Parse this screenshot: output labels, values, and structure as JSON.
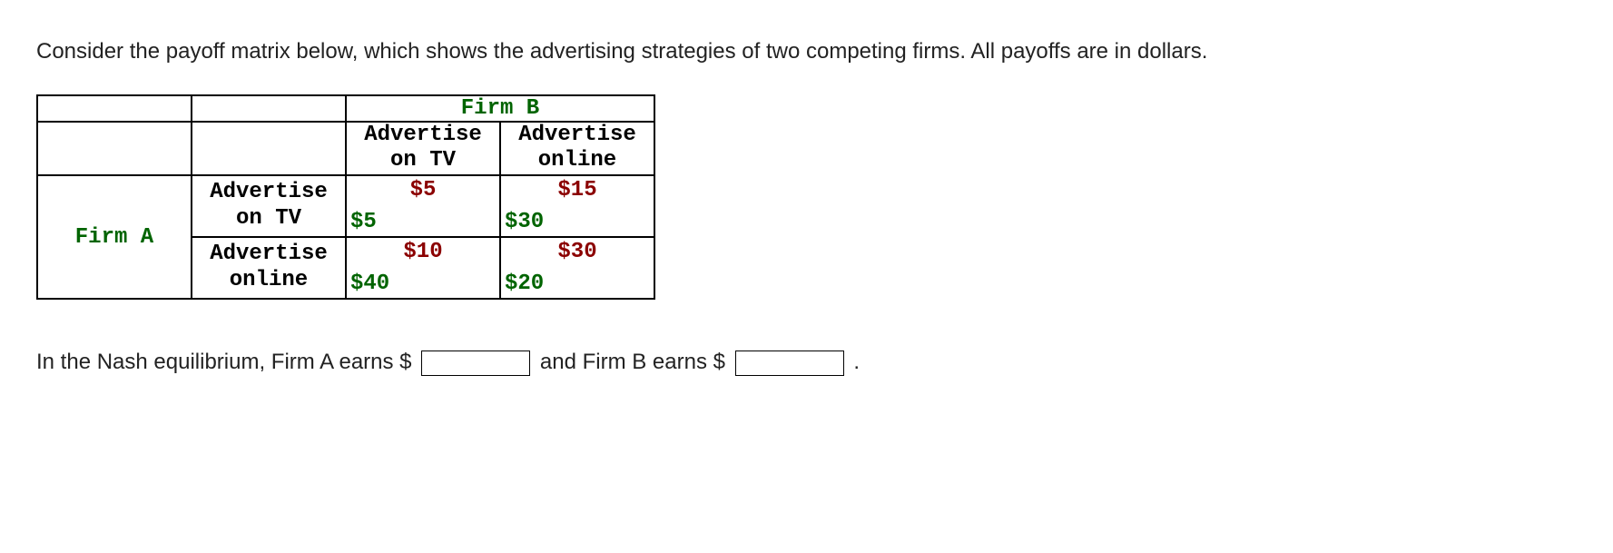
{
  "intro": "Consider the payoff matrix below, which shows the advertising strategies of two competing firms. All payoffs are in dollars.",
  "firmBLabel": "Firm B",
  "firmALabel": "Firm A",
  "firmBStrategies": {
    "tv": {
      "line1": "Advertise",
      "line2": "on TV"
    },
    "online": {
      "line1": "Advertise",
      "line2": "online"
    }
  },
  "firmAStrategies": {
    "tv": {
      "line1": "Advertise",
      "line2": "on TV"
    },
    "online": {
      "line1": "Advertise",
      "line2": "online"
    }
  },
  "payoffs": {
    "tv_tv": {
      "a": "$5",
      "b": "$5"
    },
    "tv_online": {
      "a": "$15",
      "b": "$30"
    },
    "online_tv": {
      "a": "$10",
      "b": "$40"
    },
    "online_online": {
      "a": "$30",
      "b": "$20"
    }
  },
  "question": {
    "part1": "In the Nash equilibrium, Firm A earns $",
    "part2": "and Firm B earns $",
    "part3": ".",
    "answerA": "",
    "answerB": ""
  },
  "chart_data": {
    "type": "table",
    "title": "Payoff matrix — advertising strategies",
    "row_player": "Firm A",
    "col_player": "Firm B",
    "row_strategies": [
      "Advertise on TV",
      "Advertise online"
    ],
    "col_strategies": [
      "Advertise on TV",
      "Advertise online"
    ],
    "payoffs": [
      [
        {
          "A": 5,
          "B": 5
        },
        {
          "A": 15,
          "B": 30
        }
      ],
      [
        {
          "A": 10,
          "B": 40
        },
        {
          "A": 30,
          "B": 20
        }
      ]
    ],
    "units": "dollars"
  }
}
